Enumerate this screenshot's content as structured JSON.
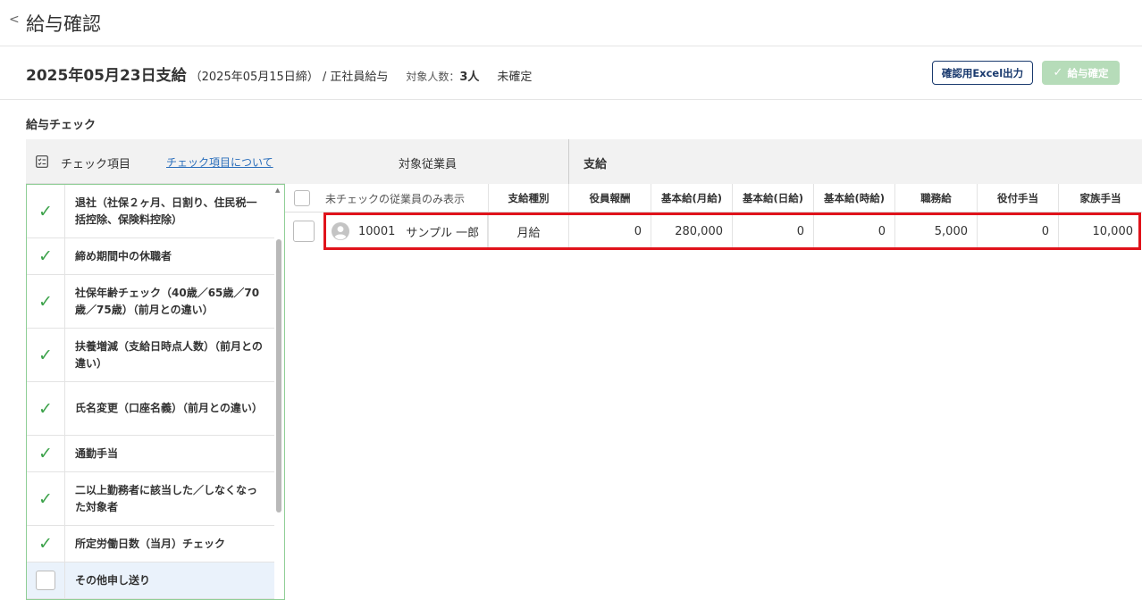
{
  "header": {
    "title": "給与確認"
  },
  "payroll": {
    "pay_date": "2025年05月23日支給",
    "closing_date": "（2025年05月15日締）",
    "pay_type": "/ 正社員給与",
    "target_label": "対象人数：",
    "target_count": "3人",
    "status": "未確定"
  },
  "actions": {
    "excel_label": "確認用Excel出力",
    "confirm_label": "給与確定"
  },
  "check_section": {
    "title": "給与チェック",
    "header_label": "チェック項目",
    "about_link": "チェック項目について",
    "items": [
      {
        "label": "退社（社保２ヶ月、日割り、住民税一括控除、保険料控除）",
        "checked": true
      },
      {
        "label": "締め期間中の休職者",
        "checked": true
      },
      {
        "label": "社保年齢チェック（40歳／65歳／70歳／75歳）（前月との違い）",
        "checked": true
      },
      {
        "label": "扶養増減（支給日時点人数）（前月との違い）",
        "checked": true
      },
      {
        "label": "氏名変更（口座名義）（前月との違い）",
        "checked": true
      },
      {
        "label": "通勤手当",
        "checked": true
      },
      {
        "label": "二以上勤務者に該当した／しなくなった対象者",
        "checked": true
      },
      {
        "label": "所定労働日数（当月）チェック",
        "checked": true
      },
      {
        "label": "その他申し送り",
        "checked": false
      }
    ]
  },
  "table": {
    "employee_group": "対象従業員",
    "pay_group": "支給",
    "filter_label": "未チェックの従業員のみ表示",
    "columns": {
      "pay_kind": "支給種別",
      "officer_pay": "役員報酬",
      "base_monthly": "基本給(月給)",
      "base_daily": "基本給(日給)",
      "base_hourly": "基本給(時給)",
      "duty_allowance": "職務給",
      "position_allowance": "役付手当",
      "family_allowance": "家族手当"
    },
    "rows": [
      {
        "code": "10001",
        "name": "サンプル 一郎",
        "pay_kind": "月給",
        "officer_pay": "0",
        "base_monthly": "280,000",
        "base_daily": "0",
        "base_hourly": "0",
        "duty_allowance": "5,000",
        "position_allowance": "0",
        "family_allowance": "10,000"
      }
    ]
  },
  "colors": {
    "accent_green": "#3ca24a",
    "highlight_red": "#e0131b",
    "link_blue": "#2a6ebb",
    "navy": "#1a3a6e"
  }
}
